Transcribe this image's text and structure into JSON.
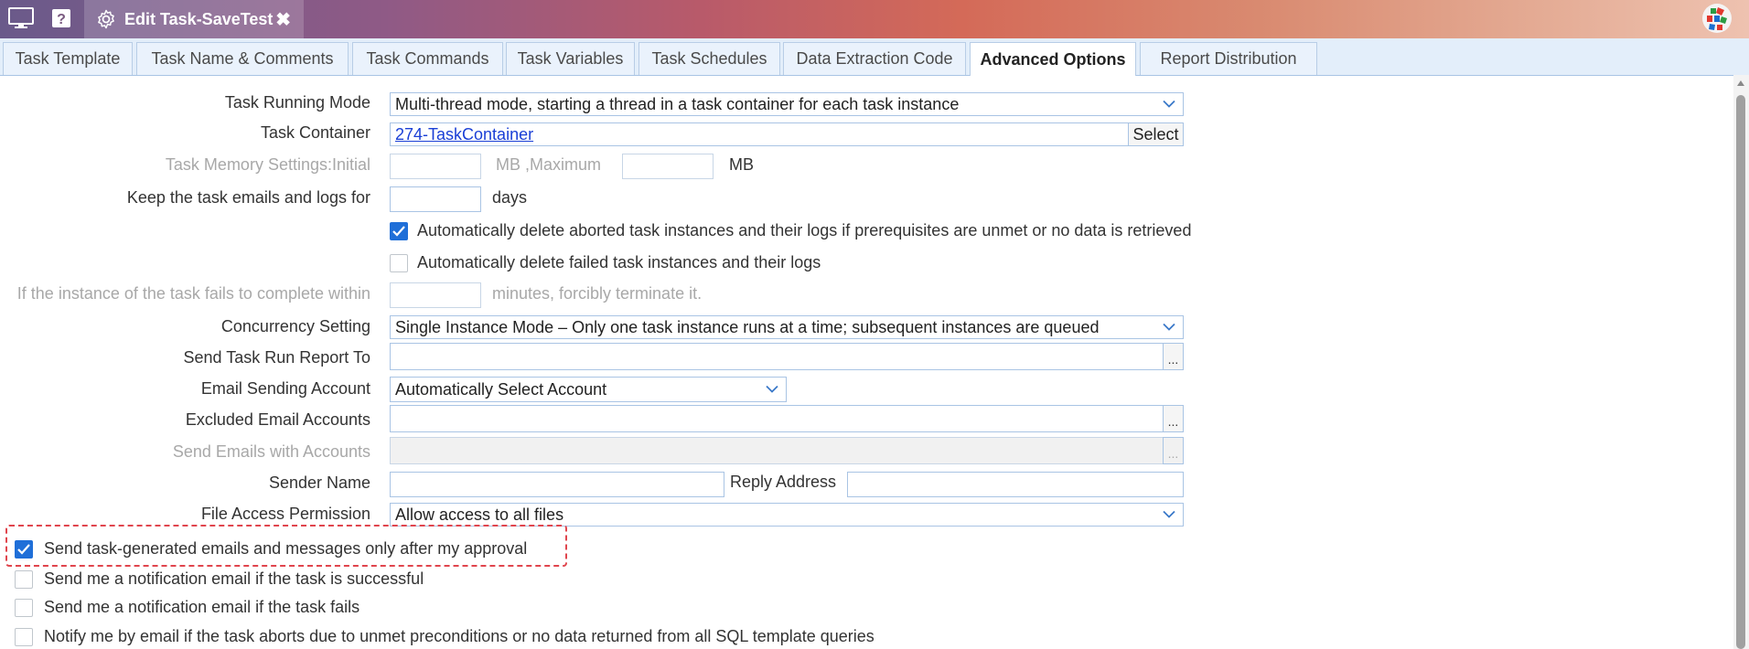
{
  "titlebar": {
    "title": "Edit Task-SaveTest",
    "close_symbol": "✖",
    "icons": [
      "monitor-icon",
      "help-icon",
      "gear-icon",
      "app-logo-icon"
    ]
  },
  "tabs": [
    {
      "label": "Task Template"
    },
    {
      "label": "Task Name & Comments"
    },
    {
      "label": "Task Commands"
    },
    {
      "label": "Task Variables"
    },
    {
      "label": "Task Schedules"
    },
    {
      "label": "Data Extraction Code"
    },
    {
      "label": "Advanced Options",
      "active": true
    },
    {
      "label": "Report Distribution"
    }
  ],
  "form": {
    "running_mode": {
      "label": "Task Running Mode",
      "value": "Multi-thread mode, starting a thread in a task container for each task instance"
    },
    "container": {
      "label": "Task Container",
      "value": "274-TaskContainer",
      "button": "Select"
    },
    "memory": {
      "label": "Task Memory Settings:Initial",
      "initial": "",
      "mid": "MB ,Maximum",
      "maximum": "",
      "unit": "MB"
    },
    "keep_logs": {
      "label": "Keep the task emails and logs for",
      "value": "",
      "unit": "days"
    },
    "auto_delete_aborted": {
      "label": "Automatically delete aborted task instances and their logs if prerequisites are unmet or no data is retrieved",
      "checked": true
    },
    "auto_delete_failed": {
      "label": "Automatically delete failed task instances and their logs",
      "checked": false
    },
    "timeout": {
      "label": "If the instance of the task fails to complete within",
      "value": "",
      "suffix": "minutes, forcibly terminate it."
    },
    "concurrency": {
      "label": "Concurrency Setting",
      "value": "Single Instance Mode – Only one task instance runs at a time; subsequent instances are queued"
    },
    "report_to": {
      "label": "Send Task Run Report To",
      "value": "",
      "button": "..."
    },
    "email_account": {
      "label": "Email Sending Account",
      "value": "Automatically Select Account"
    },
    "excluded_accounts": {
      "label": "Excluded Email Accounts",
      "value": "",
      "button": "..."
    },
    "send_with_accounts": {
      "label": "Send Emails with Accounts",
      "value": "",
      "button": "..."
    },
    "sender": {
      "label": "Sender Name",
      "value": "",
      "reply_label": "Reply Address",
      "reply_value": ""
    },
    "file_access": {
      "label": "File Access Permission",
      "value": "Allow access to all files"
    },
    "approval": {
      "label": "Send task-generated emails and messages only after my approval",
      "checked": true
    },
    "notify_success": {
      "label": "Send me a notification email if the task is successful",
      "checked": false
    },
    "notify_fail": {
      "label": "Send me a notification email if the task fails",
      "checked": false
    },
    "notify_abort": {
      "label": "Notify me by email if the task aborts due to unmet preconditions or no data returned from all SQL template queries",
      "checked": false
    }
  },
  "colors": {
    "accent": "#1f6fd8",
    "highlight_border": "#e0454d",
    "input_border": "#a9c4e4",
    "tab_bg": "#e3eefa"
  }
}
